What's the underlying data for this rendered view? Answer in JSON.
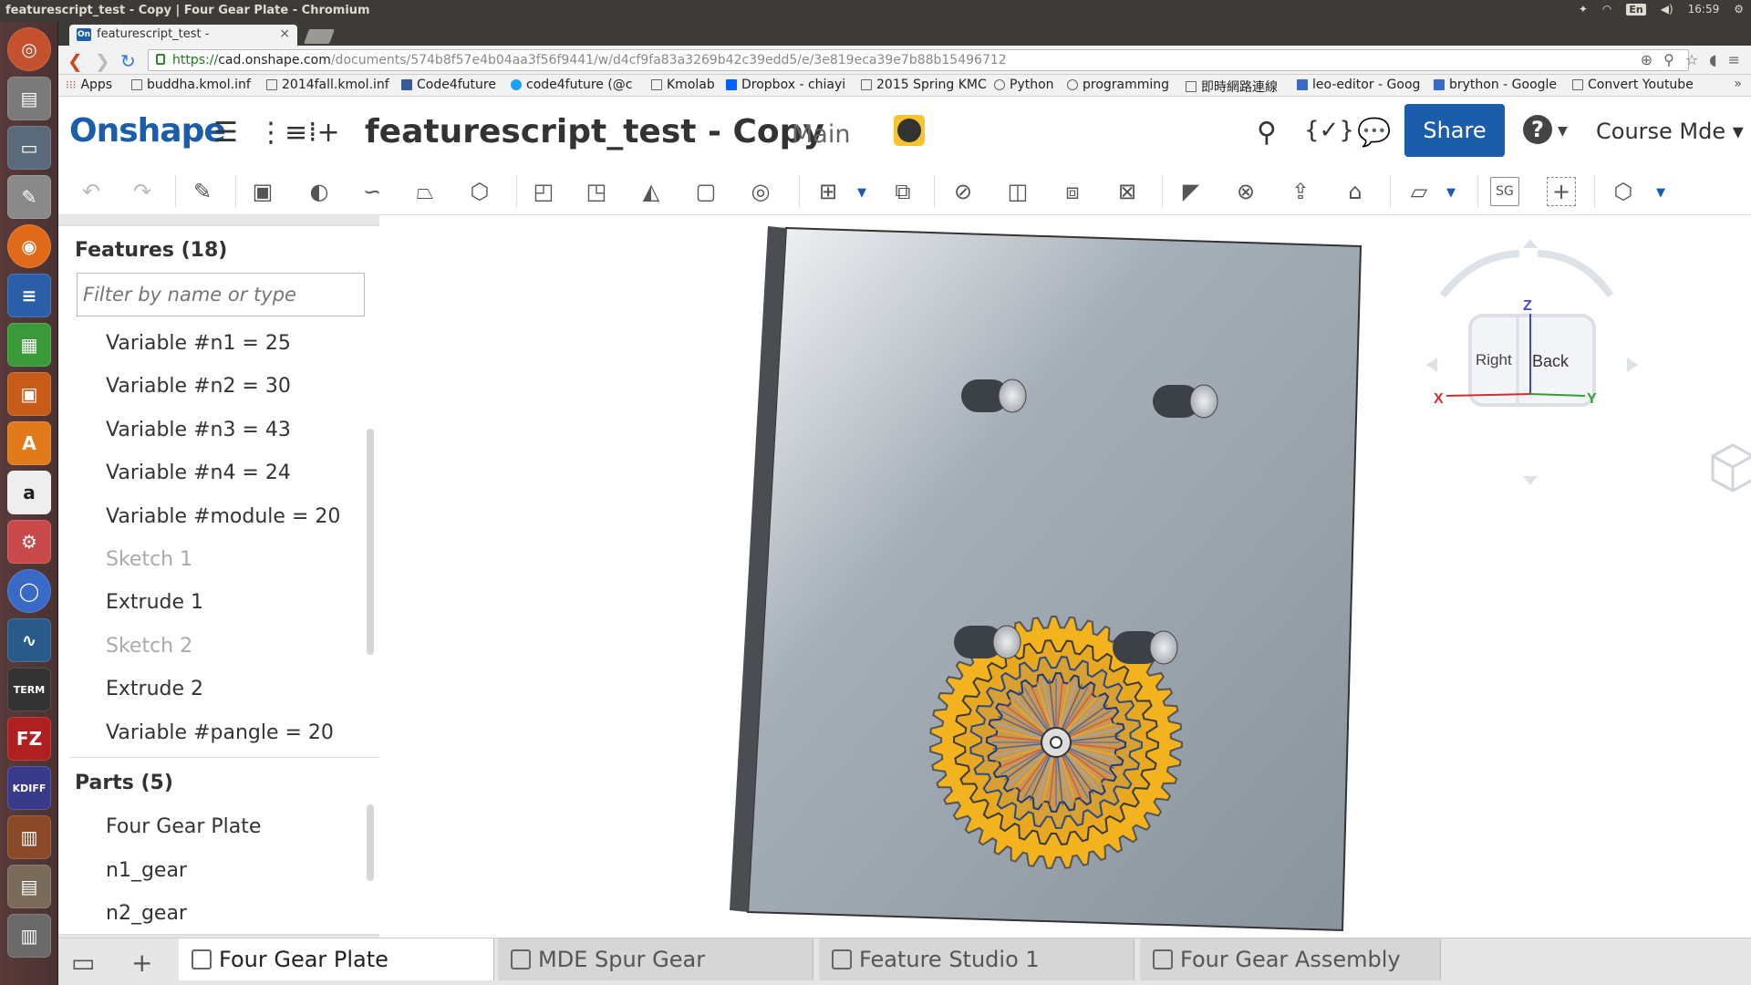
{
  "os": {
    "window_title": "featurescript_test - Copy | Four Gear Plate - Chromium",
    "lang": "En",
    "clock": "16:59"
  },
  "browser": {
    "tab_title": "featurescript_test - ",
    "favicon": "On",
    "url_scheme": "https://",
    "url_host": "cad.onshape.com",
    "url_path": "/documents/574b8f57e4b04aa3f56f9441/w/d4cf9fa83a3269b42c39edd5/e/3e819eca39e7b88b15496712",
    "bookmarks": [
      "Apps",
      "buddha.kmol.inf",
      "2014fall.kmol.inf",
      "Code4future",
      "code4future (@c",
      "Kmolab",
      "Dropbox - chiayi",
      "2015 Spring KMC",
      "Python",
      "programming",
      "即時網路連線",
      "leo-editor - Goog",
      "brython - Google",
      "Convert Youtube"
    ]
  },
  "header": {
    "logo": "Onshape",
    "doc_title": "featurescript_test - Copy",
    "workspace": "Main",
    "share_label": "Share",
    "help_label": "?",
    "user_label": "Course Mde ▾",
    "accent": "#1b5cab"
  },
  "features": {
    "heading": "Features (18)",
    "filter_placeholder": "Filter by name or type",
    "items": [
      {
        "label": "Variable #n1 = 25",
        "suppressed": false
      },
      {
        "label": "Variable #n2 = 30",
        "suppressed": false
      },
      {
        "label": "Variable #n3 = 43",
        "suppressed": false
      },
      {
        "label": "Variable #n4 = 24",
        "suppressed": false
      },
      {
        "label": "Variable #module = 20",
        "suppressed": false
      },
      {
        "label": "Sketch 1",
        "suppressed": true
      },
      {
        "label": "Extrude 1",
        "suppressed": false
      },
      {
        "label": "Sketch 2",
        "suppressed": true
      },
      {
        "label": "Extrude 2",
        "suppressed": false
      },
      {
        "label": "Variable #pangle = 20",
        "suppressed": false
      }
    ]
  },
  "parts": {
    "heading": "Parts (5)",
    "items": [
      "Four Gear Plate",
      "n1_gear",
      "n2_gear"
    ]
  },
  "viewcube": {
    "top": "Z",
    "left_axis": "X",
    "right_axis": "Y",
    "face_right": "Right",
    "face_back": "Back"
  },
  "toolbar": {
    "sg_label": "SG"
  },
  "tabs": [
    {
      "label": "Four Gear Plate",
      "active": true
    },
    {
      "label": "MDE Spur Gear",
      "active": false
    },
    {
      "label": "Feature Studio 1",
      "active": false
    },
    {
      "label": "Four Gear Assembly",
      "active": false
    }
  ]
}
